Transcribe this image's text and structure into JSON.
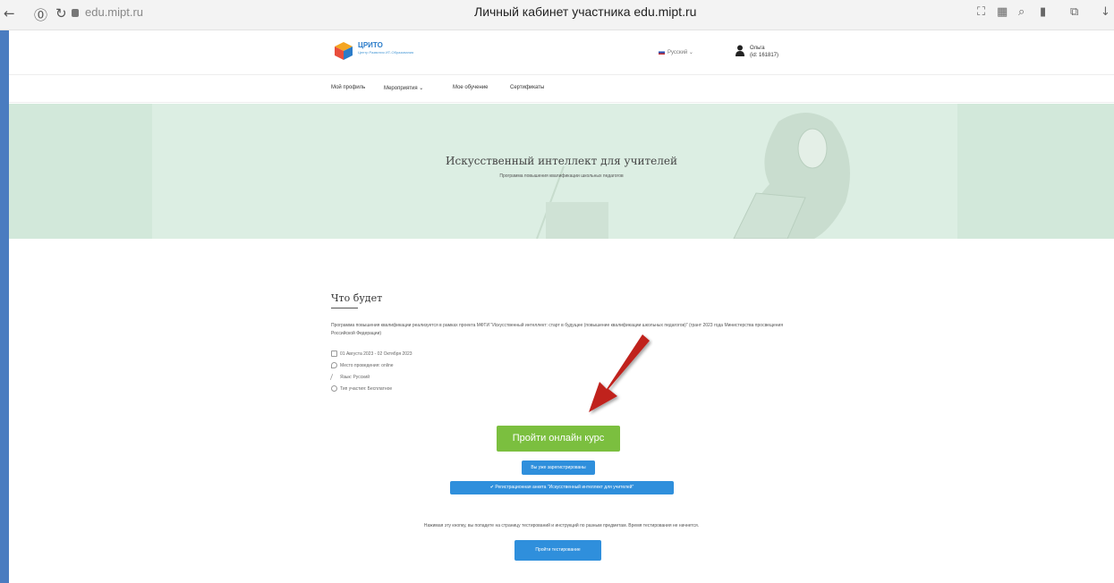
{
  "browser": {
    "url": "edu.mipt.ru",
    "tab_title": "Личный кабинет участника edu.mipt.ru"
  },
  "header": {
    "logo_text": "ЦРИТО",
    "logo_subtext": "Центр Развития ИТ-Образования",
    "language": "Русский",
    "user_name": "Ольга",
    "user_id": "(id: 161817)"
  },
  "menu": {
    "items": [
      "Мой профиль",
      "Мероприятия",
      "Мое обучение",
      "Сертификаты"
    ]
  },
  "banner": {
    "title": "Искусственный интеллект для учителей",
    "subtitle": "Программа повышения квалификации школьных педагогов"
  },
  "section": {
    "title": "Что будет",
    "description": "Программа повышения квалификации реализуется в рамках проекта МФТИ \"Искусственный интеллект: старт в будущее (повышение квалификации школьных педагогов)\" (грант 2023 года Министерства просвещения Российской Федерации)",
    "dates": "01 Августа 2023 - 02 Октября 2023",
    "place": "Место проведения: online",
    "language": "Язык: Русский",
    "participation": "Тип участия: Бесплатное"
  },
  "buttons": {
    "online_course": "Пройти онлайн курс",
    "registered": "Вы уже зарегистрированы",
    "registration_form": "✔ Регистрационная анкета \"Искусственный интеллект для учителей\"",
    "testing": "Пройти тестирование"
  },
  "note": "Нажимая эту кнопку, вы попадете на страницу тестирований и инструкций по разным предметам. Время тестирования не начнется.",
  "colors": {
    "green_button": "#7bbf3f",
    "blue_button": "#2f8fdc",
    "arrow": "#c0201f",
    "banner": "#dceee3"
  }
}
